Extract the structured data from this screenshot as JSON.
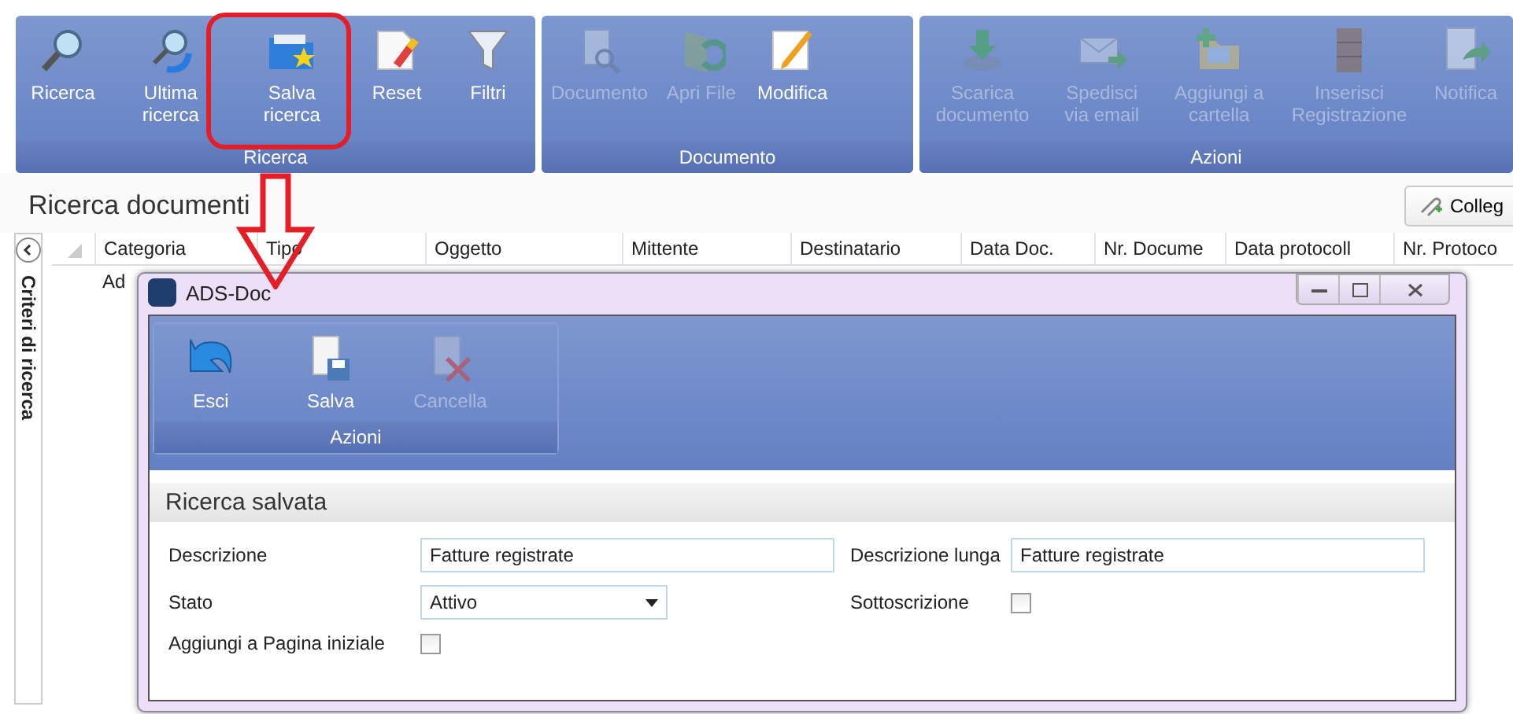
{
  "ribbon": {
    "groups": [
      {
        "label": "Ricerca",
        "buttons": [
          {
            "label": "Ricerca",
            "kind": "search",
            "disabled": false
          },
          {
            "label": "Ultima ricerca",
            "kind": "last-search",
            "disabled": false
          },
          {
            "label": "Salva ricerca",
            "kind": "folder-star",
            "disabled": false
          },
          {
            "label": "Reset",
            "kind": "eraser",
            "disabled": false
          },
          {
            "label": "Filtri",
            "kind": "funnel",
            "disabled": false
          }
        ]
      },
      {
        "label": "Documento",
        "buttons": [
          {
            "label": "Documento",
            "kind": "doc-search",
            "disabled": true
          },
          {
            "label": "Apri File",
            "kind": "folder-arrow",
            "disabled": true
          },
          {
            "label": "Modifica",
            "kind": "pencil",
            "disabled": false
          }
        ]
      },
      {
        "label": "Azioni",
        "buttons": [
          {
            "label": "Scarica documento",
            "kind": "download",
            "disabled": true
          },
          {
            "label": "Spedisci via email",
            "kind": "mail",
            "disabled": true
          },
          {
            "label": "Aggiungi a cartella",
            "kind": "folder-add",
            "disabled": true
          },
          {
            "label": "Inserisci Registrazione",
            "kind": "cabinet",
            "disabled": true
          },
          {
            "label": "Notifica",
            "kind": "doc-arrow",
            "disabled": true
          }
        ]
      }
    ]
  },
  "page_title": "Ricerca documenti",
  "link_button": "Colleg",
  "side_panel": {
    "label": "Criteri di ricerca"
  },
  "table": {
    "columns": [
      "Categoria",
      "Tipo",
      "Oggetto",
      "Mittente",
      "Destinatario",
      "Data Doc.",
      "Nr. Docume",
      "Data protocoll",
      "Nr. Protoco"
    ],
    "rows": [
      [
        "Ad"
      ]
    ]
  },
  "dialog": {
    "title": "ADS-Doc",
    "ribbon_group": {
      "label": "Azioni",
      "buttons": [
        {
          "label": "Esci",
          "kind": "undo",
          "disabled": false
        },
        {
          "label": "Salva",
          "kind": "save",
          "disabled": false
        },
        {
          "label": "Cancella",
          "kind": "delete",
          "disabled": true
        }
      ]
    },
    "section_title": "Ricerca salvata",
    "fields": [
      {
        "label": "Descrizione",
        "kind": "text",
        "value": "Fatture registrate"
      },
      {
        "label": "Descrizione lunga",
        "kind": "text",
        "value": "Fatture registrate"
      },
      {
        "label": "Stato",
        "kind": "select",
        "value": "Attivo"
      },
      {
        "label": "Sottoscrizione",
        "kind": "checkbox",
        "checked": false
      },
      {
        "label": "Aggiungi a Pagina iniziale",
        "kind": "checkbox",
        "checked": false
      }
    ]
  }
}
